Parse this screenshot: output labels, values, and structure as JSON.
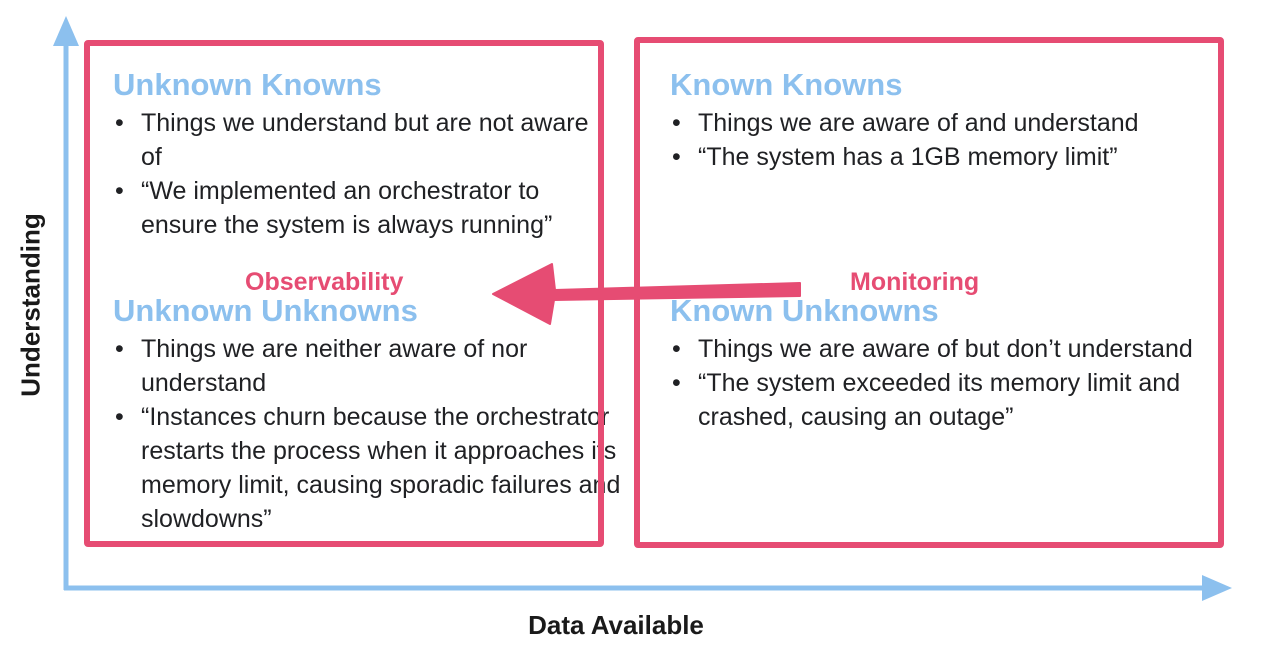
{
  "diagram": {
    "x_axis_label": "Data Available",
    "y_axis_label": "Understanding",
    "quadrants": {
      "top_left": {
        "title": "Unknown Knowns",
        "bullets": [
          "Things we understand but are not aware of",
          "“We implemented an orchestrator to ensure the system is always running”"
        ]
      },
      "bottom_left": {
        "title": "Unknown Unknowns",
        "bullets": [
          "Things we are neither aware of nor understand",
          "“Instances churn because the orchestrator restarts the process when it approaches its memory limit, causing sporadic failures and slowdowns”"
        ]
      },
      "top_right": {
        "title": "Known Knowns",
        "bullets": [
          "Things we are aware of and understand",
          "“The system has a 1GB memory limit”"
        ]
      },
      "bottom_right": {
        "title": "Known Unknowns",
        "bullets": [
          "Things we are aware of but don’t understand",
          "“The system exceeded its memory limit and crashed, causing an outage”"
        ]
      }
    },
    "left_box_label": "Observability",
    "right_box_label": "Monitoring",
    "colors": {
      "axis": "#8cc0ee",
      "title": "#8cc0ee",
      "highlight": "#e64c73",
      "text": "#202124"
    }
  }
}
